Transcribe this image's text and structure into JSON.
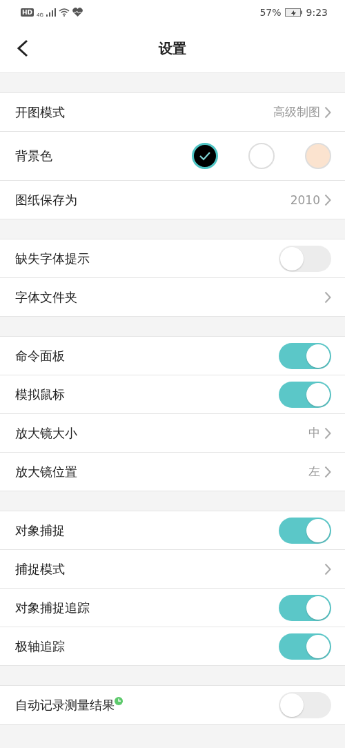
{
  "status_bar": {
    "network_badge": "HD",
    "network_type": "4G",
    "battery": "57%",
    "time": "9:23"
  },
  "header": {
    "title": "设置"
  },
  "groups": [
    {
      "rows": [
        {
          "kind": "link",
          "label": "开图模式",
          "value": "高级制图"
        },
        {
          "kind": "colors",
          "label": "背景色",
          "swatches": [
            {
              "color": "#000000",
              "selected": true
            },
            {
              "color": "#ffffff",
              "selected": false
            },
            {
              "color": "#fbe3cf",
              "selected": false
            }
          ]
        },
        {
          "kind": "link",
          "label": "图纸保存为",
          "value": "2010"
        }
      ]
    },
    {
      "rows": [
        {
          "kind": "toggle",
          "label": "缺失字体提示",
          "on": false
        },
        {
          "kind": "link",
          "label": "字体文件夹"
        }
      ]
    },
    {
      "rows": [
        {
          "kind": "toggle",
          "label": "命令面板",
          "on": true
        },
        {
          "kind": "toggle",
          "label": "模拟鼠标",
          "on": true
        },
        {
          "kind": "link",
          "label": "放大镜大小",
          "value": "中"
        },
        {
          "kind": "link",
          "label": "放大镜位置",
          "value": "左"
        }
      ]
    },
    {
      "rows": [
        {
          "kind": "toggle",
          "label": "对象捕捉",
          "on": true
        },
        {
          "kind": "link",
          "label": "捕捉模式"
        },
        {
          "kind": "toggle",
          "label": "对象捕捉追踪",
          "on": true
        },
        {
          "kind": "toggle",
          "label": "极轴追踪",
          "on": true
        }
      ]
    },
    {
      "rows": [
        {
          "kind": "toggle",
          "label": "自动记录测量结果",
          "on": false,
          "badge": true
        }
      ]
    }
  ]
}
